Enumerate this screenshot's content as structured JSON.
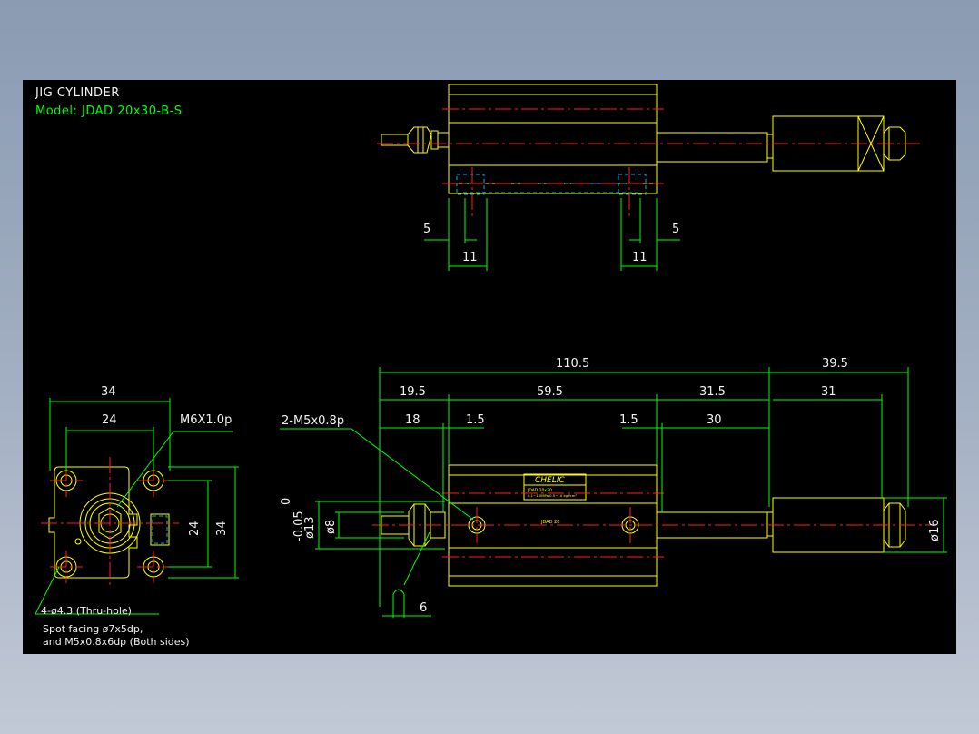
{
  "drawing": {
    "title": "JIG CYLINDER",
    "model": "Model:  JDAD 20x30-B-S",
    "colors": {
      "background": "#000000",
      "outline": "#ffff00",
      "dimension": "#00ff00",
      "centerline": "#ff2020",
      "hidden": "#00b4ff",
      "text": "#f2f2f2",
      "title": "#f2f2f2",
      "model": "#00ff00"
    }
  },
  "top_view": {
    "dims": {
      "left_5": "5",
      "right_5": "5",
      "left_11": "11",
      "right_11": "11"
    }
  },
  "end_view": {
    "dims": {
      "width_34": "34",
      "pitch_24": "24",
      "height_24": "24",
      "height_34": "34"
    },
    "thread_note": "M6X1.0p",
    "hole_note": "4-ø4.3 (Thru-hole)",
    "spot_note_1": "Spot facing ø7x5dp,",
    "spot_note_2": "and M5x0.8x6dp (Both sides)"
  },
  "side_view": {
    "dims": {
      "total_110_5": "110.5",
      "rod_39_5": "39.5",
      "d_19_5": "19.5",
      "d_59_5": "59.5",
      "d_31_5": "31.5",
      "d_31": "31",
      "d_18": "18",
      "d_1_5_left": "1.5",
      "d_1_5_right": "1.5",
      "d_30": "30",
      "d_6": "6"
    },
    "port_note": "2-M5x0.8p",
    "tol_upper": "0",
    "tol_lower": "-0.05",
    "dia_13": "ø13",
    "dia_8": "ø8",
    "dia_16": "ø16",
    "label_brand": "CHELIC",
    "label_line_1": "JDAD 20x30",
    "label_line_2": "0.1~1.0MPa 0.5~10 kgf/cm²",
    "body_marking": "JDAD 20"
  }
}
